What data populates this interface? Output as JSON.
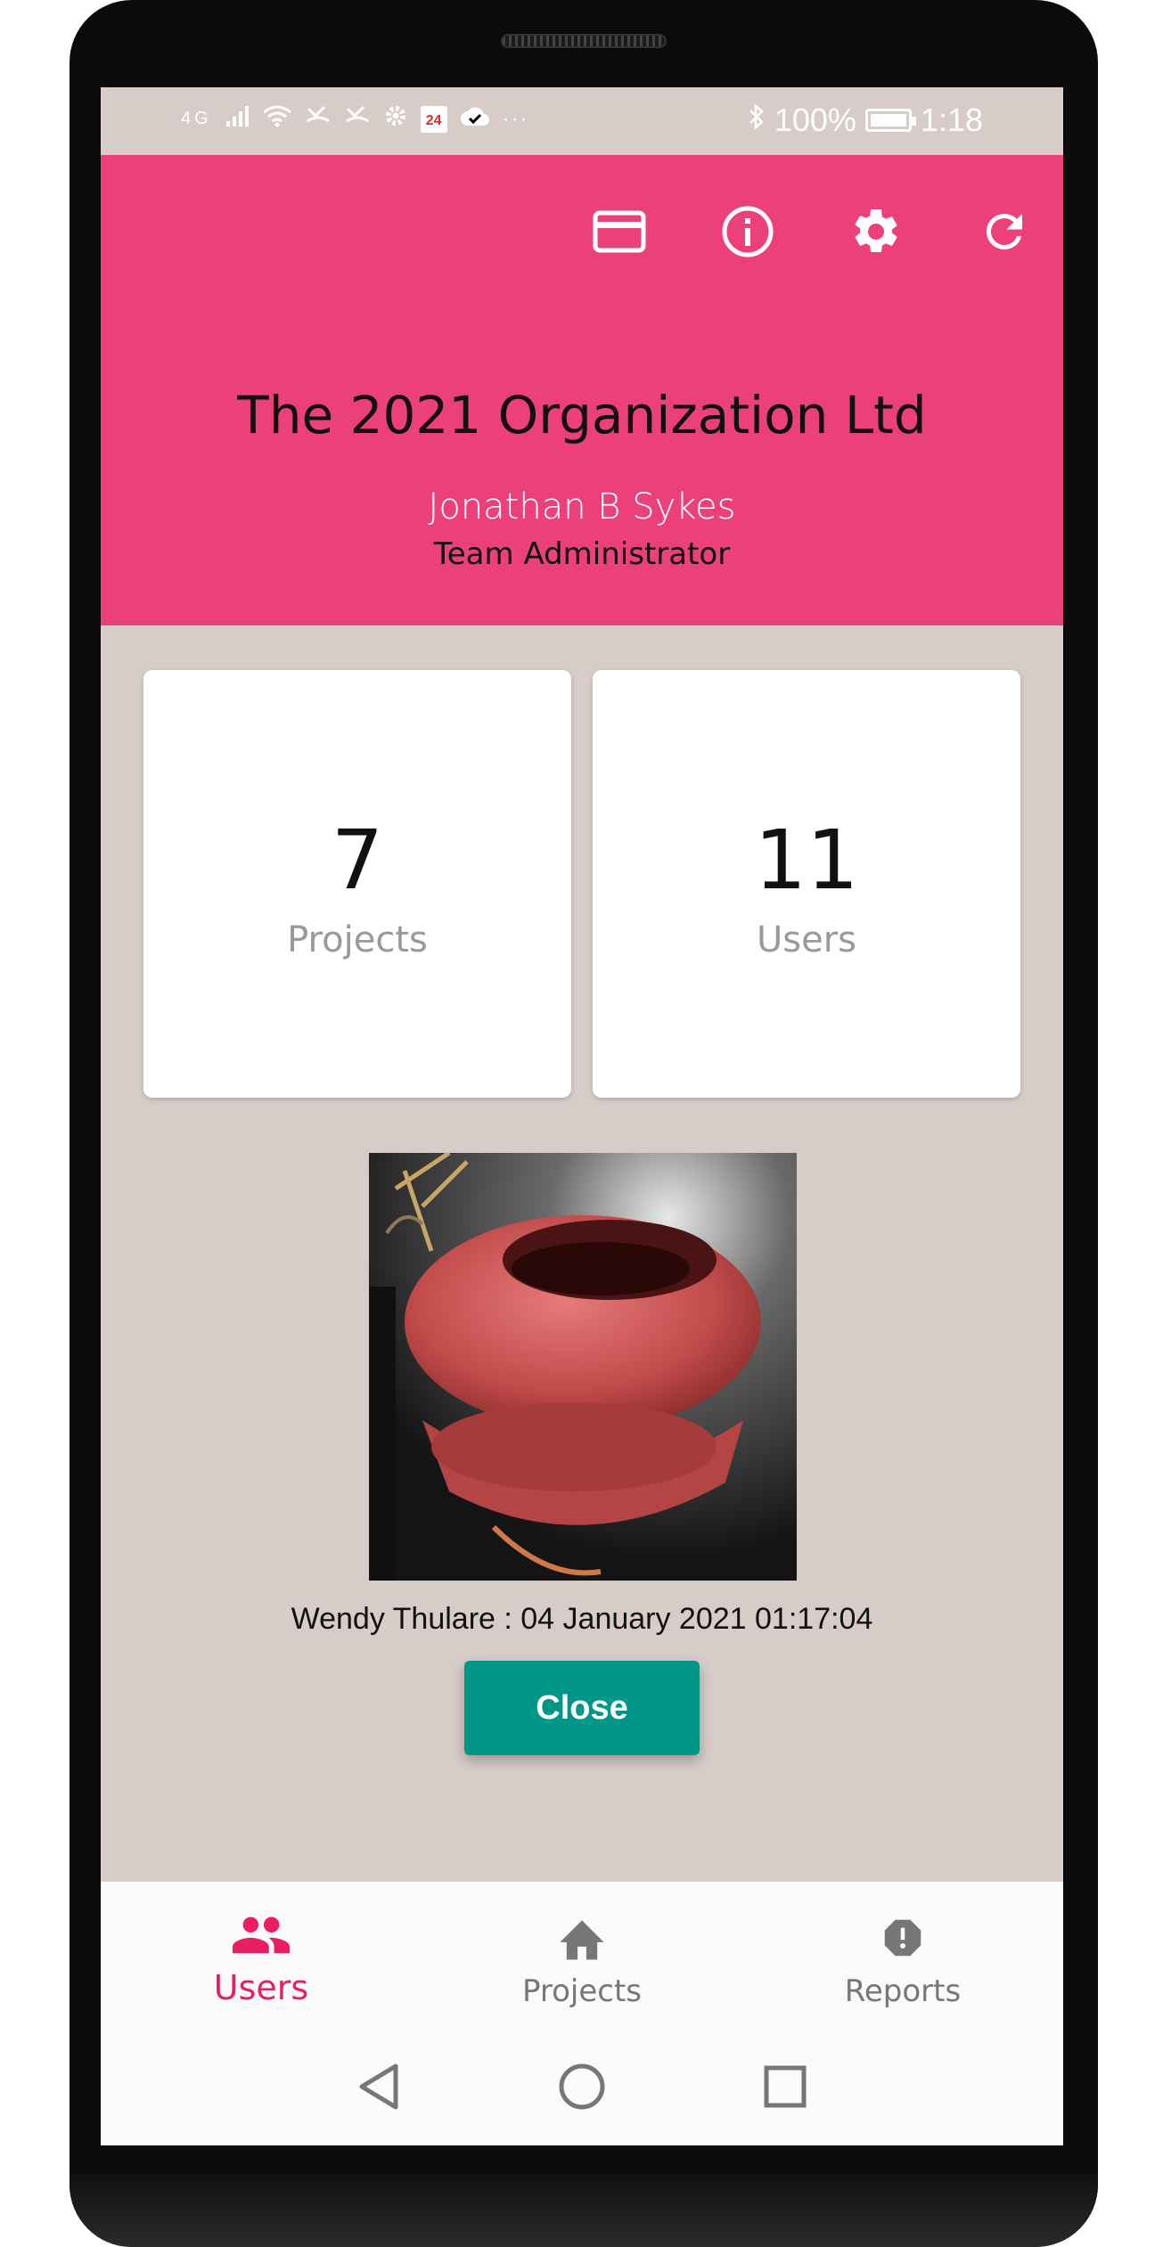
{
  "status_bar": {
    "network": "4G",
    "calendar_day": "24",
    "more": "···",
    "battery": "100%",
    "time": "1:18"
  },
  "header": {
    "icons": [
      "credit-card-icon",
      "info-icon",
      "settings-icon",
      "refresh-icon"
    ],
    "org_name": "The 2021 Organization Ltd",
    "user_name": "Jonathan B Sykes",
    "user_role": "Team Administrator",
    "background_color": "#ec407a"
  },
  "stats": {
    "projects": {
      "value": "7",
      "label": "Projects"
    },
    "users": {
      "value": "11",
      "label": "Users"
    }
  },
  "photo": {
    "caption": "Wendy Thulare : 04 January 2021 01:17:04"
  },
  "actions": {
    "close_label": "Close",
    "close_color": "#009688"
  },
  "bottom_nav": {
    "items": [
      {
        "label": "Users",
        "icon": "users-icon",
        "active": true
      },
      {
        "label": "Projects",
        "icon": "home-icon",
        "active": false
      },
      {
        "label": "Reports",
        "icon": "alert-icon",
        "active": false
      }
    ],
    "active_color": "#e91e63"
  },
  "system_nav": [
    "back-icon",
    "home-circle-icon",
    "recents-icon"
  ]
}
